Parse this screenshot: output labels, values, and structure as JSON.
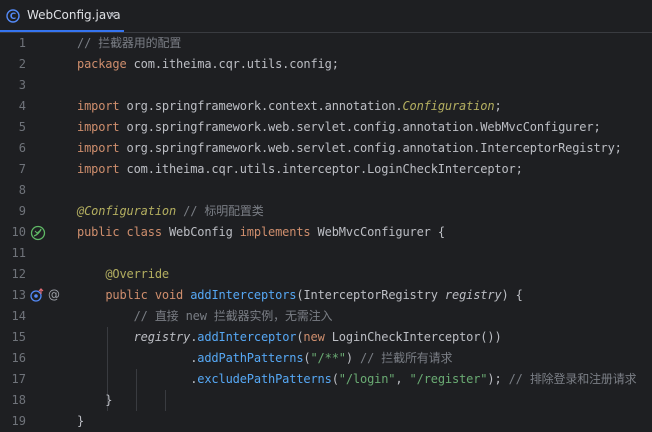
{
  "tab": {
    "label": "WebConfig.java",
    "close_icon": "close-icon",
    "file_icon": "java-class-icon"
  },
  "colors": {
    "accent": "#3574f0",
    "keyword": "#cf8e6d",
    "comment": "#7a7e85",
    "annotation": "#b3ae60",
    "method": "#56a8f5",
    "string": "#6aab73"
  },
  "gutter_icons": {
    "line10": "bean-icon",
    "line13": [
      "implemented-method-icon",
      "annotation-at-icon"
    ]
  },
  "lines": [
    {
      "n": "1",
      "t": [
        [
          "c",
          "// 拦截器用的配置"
        ]
      ]
    },
    {
      "n": "2",
      "t": [
        [
          "k",
          "package"
        ],
        [
          "cls",
          " com.itheima.cqr.utils.config;"
        ]
      ]
    },
    {
      "n": "3",
      "t": []
    },
    {
      "n": "4",
      "t": [
        [
          "k",
          "import"
        ],
        [
          "cls",
          " org.springframework.context.annotation."
        ],
        [
          "a it",
          "Configuration"
        ],
        [
          "cls",
          ";"
        ]
      ]
    },
    {
      "n": "5",
      "t": [
        [
          "k",
          "import"
        ],
        [
          "cls",
          " org.springframework.web.servlet.config.annotation.WebMvcConfigurer;"
        ]
      ]
    },
    {
      "n": "6",
      "t": [
        [
          "k",
          "import"
        ],
        [
          "cls",
          " org.springframework.web.servlet.config.annotation.InterceptorRegistry;"
        ]
      ]
    },
    {
      "n": "7",
      "t": [
        [
          "k",
          "import"
        ],
        [
          "cls",
          " com.itheima.cqr.utils.interceptor.LoginCheckInterceptor;"
        ]
      ]
    },
    {
      "n": "8",
      "t": []
    },
    {
      "n": "9",
      "t": [
        [
          "a it",
          "@Configuration"
        ],
        [
          "c",
          " // 标明配置类"
        ]
      ]
    },
    {
      "n": "10",
      "t": [
        [
          "k",
          "public class"
        ],
        [
          "cls",
          " WebConfig "
        ],
        [
          "k",
          "implements"
        ],
        [
          "cls",
          " WebMvcConfigurer {"
        ]
      ]
    },
    {
      "n": "11",
      "t": []
    },
    {
      "n": "12",
      "t": [
        [
          "cls",
          "    "
        ],
        [
          "a",
          "@Override"
        ]
      ]
    },
    {
      "n": "13",
      "t": [
        [
          "cls",
          "    "
        ],
        [
          "k",
          "public void"
        ],
        [
          "cls",
          " "
        ],
        [
          "m",
          "addInterceptors"
        ],
        [
          "cls",
          "(InterceptorRegistry "
        ],
        [
          "p",
          "registry"
        ],
        [
          "cls",
          ") {"
        ]
      ]
    },
    {
      "n": "14",
      "t": [
        [
          "cls",
          "        "
        ],
        [
          "c",
          "// 直接 new 拦截器实例，无需注入"
        ]
      ]
    },
    {
      "n": "15",
      "t": [
        [
          "cls",
          "        "
        ],
        [
          "p",
          "registry"
        ],
        [
          "cls",
          "."
        ],
        [
          "m",
          "addInterceptor"
        ],
        [
          "cls",
          "("
        ],
        [
          "k",
          "new"
        ],
        [
          "cls",
          " LoginCheckInterceptor())"
        ]
      ]
    },
    {
      "n": "16",
      "t": [
        [
          "cls",
          "                ."
        ],
        [
          "m",
          "addPathPatterns"
        ],
        [
          "cls",
          "("
        ],
        [
          "s",
          "\"/**\""
        ],
        [
          "cls",
          ") "
        ],
        [
          "c",
          "// 拦截所有请求"
        ]
      ]
    },
    {
      "n": "17",
      "t": [
        [
          "cls",
          "                ."
        ],
        [
          "m",
          "excludePathPatterns"
        ],
        [
          "cls",
          "("
        ],
        [
          "s",
          "\"/login\""
        ],
        [
          "cls",
          ", "
        ],
        [
          "s",
          "\"/register\""
        ],
        [
          "cls",
          "); "
        ],
        [
          "c",
          "// 排除登录和注册请求"
        ]
      ]
    },
    {
      "n": "18",
      "t": [
        [
          "cls",
          "    }"
        ]
      ]
    },
    {
      "n": "19",
      "t": [
        [
          "cls",
          "}"
        ]
      ]
    }
  ]
}
